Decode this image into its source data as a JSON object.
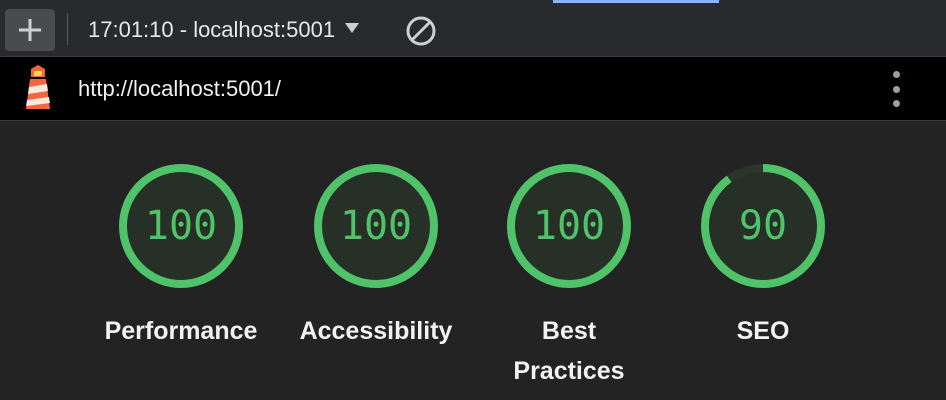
{
  "toolbar": {
    "report_label": "17:01:10 - localhost:5001",
    "add_icon": "plus-icon",
    "clear_icon": "block-icon"
  },
  "urlbar": {
    "url": "http://localhost:5001/",
    "logo_icon": "lighthouse-icon",
    "menu_icon": "more-vert-icon"
  },
  "gauges": [
    {
      "score": "100",
      "value": 100,
      "label_lines": [
        "Performance"
      ]
    },
    {
      "score": "100",
      "value": 100,
      "label_lines": [
        "Accessibility"
      ]
    },
    {
      "score": "100",
      "value": 100,
      "label_lines": [
        "Best",
        "Practices"
      ]
    },
    {
      "score": "90",
      "value": 90,
      "label_lines": [
        "SEO"
      ]
    }
  ],
  "colors": {
    "pass": "#4fc26a",
    "gauge_track": "#2a352c",
    "gauge_fill": "#263026"
  }
}
